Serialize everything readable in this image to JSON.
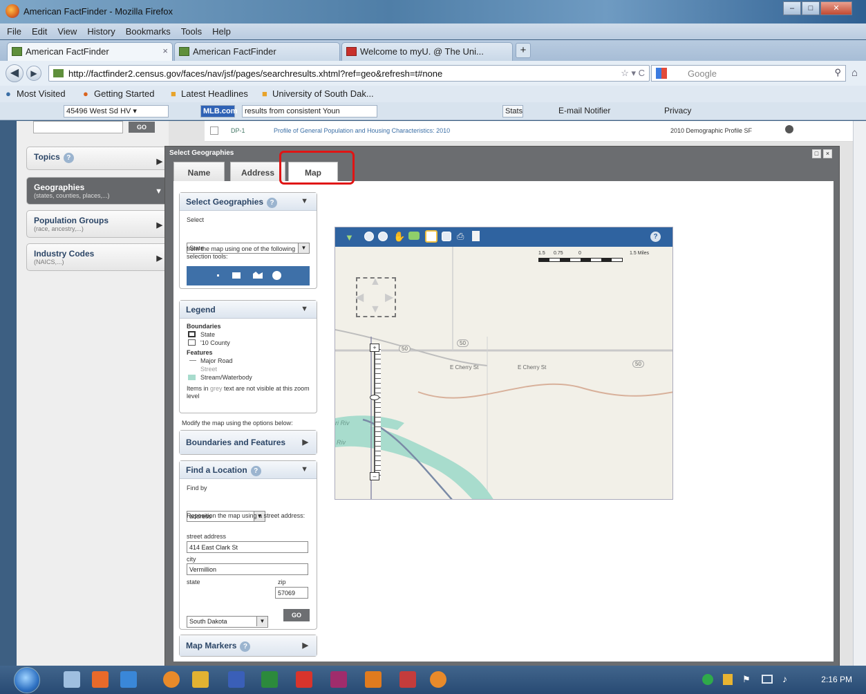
{
  "window": {
    "title": "American FactFinder - Mozilla Firefox"
  },
  "menu": [
    "File",
    "Edit",
    "View",
    "History",
    "Bookmarks",
    "Tools",
    "Help"
  ],
  "tabs": [
    {
      "label": "American FactFinder",
      "active": true
    },
    {
      "label": "American FactFinder",
      "active": false
    },
    {
      "label": "Welcome to myU. @ The Uni...",
      "active": false
    }
  ],
  "nav": {
    "url": "http://factfinder2.census.gov/faces/nav/jsf/pages/searchresults.xhtml?ref=geo&refresh=t#none",
    "search_placeholder": "Google"
  },
  "bookmarks": [
    "Most Visited",
    "Getting Started",
    "Latest Headlines",
    "University of South Dak..."
  ],
  "toolbar": {
    "location": "45496 West Sd HV",
    "mlb": "MLB.com",
    "results_text": "results from consistent Youn",
    "stats": "Stats",
    "email": "E-mail Notifier",
    "privacy": "Privacy"
  },
  "sidebar": {
    "go_label": "GO",
    "items": [
      {
        "label": "Topics",
        "sub": ""
      },
      {
        "label": "Geographies",
        "sub": "(states, counties, places,...)"
      },
      {
        "label": "Population Groups",
        "sub": "(race, ancestry,...)"
      },
      {
        "label": "Industry Codes",
        "sub": "(NAICS,...)"
      }
    ]
  },
  "background_table": {
    "row_id": "DP-1",
    "row_title": "Profile of General Population and Housing Characteristics: 2010",
    "row_source": "2010 Demographic Profile SF"
  },
  "dialog": {
    "title": "Select Geographies",
    "tabs": [
      "Name",
      "Address",
      "Map"
    ],
    "select_panel": {
      "title": "Select Geographies",
      "select_label": "Select",
      "select_value": "State",
      "instructions": "from the map using one of the following selection tools:"
    },
    "legend": {
      "title": "Legend",
      "boundaries_heading": "Boundaries",
      "boundaries": [
        "State",
        "'10 County"
      ],
      "features_heading": "Features",
      "features": [
        "Major Road",
        "Street",
        "Stream/Waterbody"
      ],
      "note_before": "Items in ",
      "note_grey": "grey",
      "note_after": " text are not visible at this zoom level"
    },
    "modify_text": "Modify the map using the options below:",
    "boundaries_features": "Boundaries and Features",
    "find_location": {
      "title": "Find a Location",
      "find_by_label": "Find by",
      "find_by_value": "address",
      "instructions": "Reposition the map using a street address:",
      "street_label": "street address",
      "street_value": "414 East Clark St",
      "city_label": "city",
      "city_value": "Vermillion",
      "state_label": "state",
      "state_value": "South Dakota",
      "zip_label": "zip",
      "zip_value": "57069",
      "go_label": "GO"
    },
    "map_markers": "Map Markers"
  },
  "map": {
    "scale_labels": [
      "1.5",
      "0.75",
      "0",
      "1.5 Miles"
    ],
    "road_labels": [
      "50",
      "50",
      "E Cherry St",
      "E Cherry St",
      "50"
    ],
    "river_labels": [
      "ri Riv",
      "Riv"
    ]
  },
  "taskbar": {
    "time": "2:16 PM"
  },
  "colors": {
    "highlight_box": "#e01414",
    "map_toolbar": "#2f63a0",
    "dialog_frame": "#6b6d70"
  }
}
